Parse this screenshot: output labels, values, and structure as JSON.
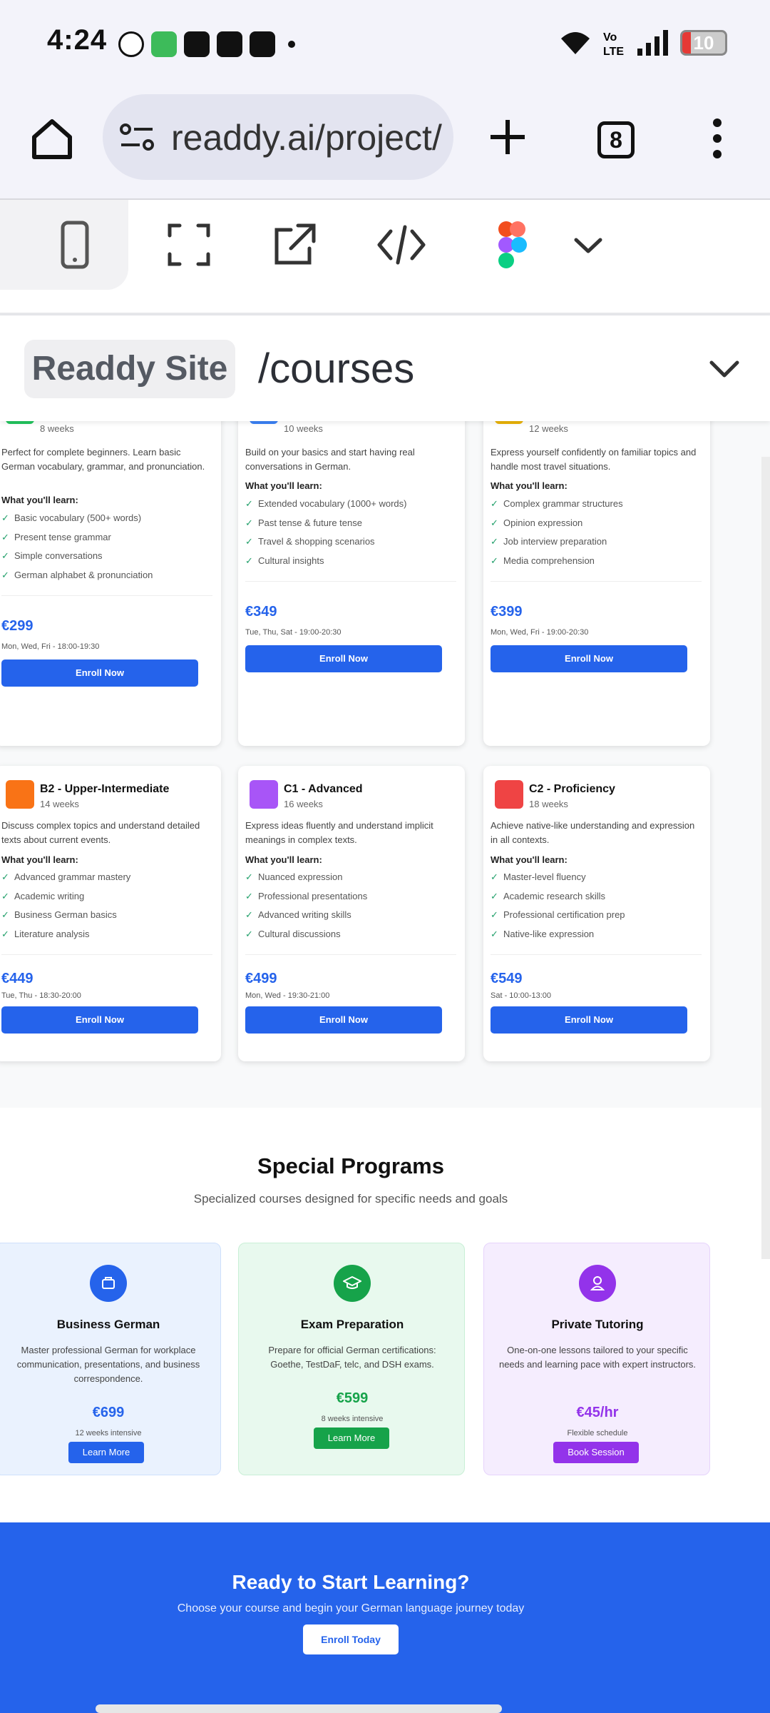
{
  "status_bar": {
    "time": "4:24",
    "battery": "10"
  },
  "browser": {
    "url": "readdy.ai/project/",
    "tab_count": "8"
  },
  "readdy": {
    "site_label": "Readdy Site",
    "path": "/courses"
  },
  "courses": [
    {
      "title": "",
      "duration": "8 weeks",
      "color": "#22c55e",
      "description": "Perfect for complete beginners. Learn basic German vocabulary, grammar, and pronunciation.",
      "learn_label": "What you'll learn:",
      "items": [
        "Basic vocabulary (500+ words)",
        "Present tense grammar",
        "Simple conversations",
        "German alphabet & pronunciation"
      ],
      "price": "€299",
      "schedule": "Mon, Wed, Fri - 18:00-19:30",
      "button": "Enroll Now"
    },
    {
      "title": "",
      "duration": "10 weeks",
      "color": "#3b82f6",
      "description": "Build on your basics and start having real conversations in German.",
      "learn_label": "What you'll learn:",
      "items": [
        "Extended vocabulary (1000+ words)",
        "Past tense & future tense",
        "Travel & shopping scenarios",
        "Cultural insights"
      ],
      "price": "€349",
      "schedule": "Tue, Thu, Sat - 19:00-20:30",
      "button": "Enroll Now"
    },
    {
      "title": "",
      "duration": "12 weeks",
      "color": "#eab308",
      "description": "Express yourself confidently on familiar topics and handle most travel situations.",
      "learn_label": "What you'll learn:",
      "items": [
        "Complex grammar structures",
        "Opinion expression",
        "Job interview preparation",
        "Media comprehension"
      ],
      "price": "€399",
      "schedule": "Mon, Wed, Fri - 19:00-20:30",
      "button": "Enroll Now"
    },
    {
      "title": "B2 - Upper-Intermediate",
      "duration": "14 weeks",
      "color": "#f97316",
      "description": "Discuss complex topics and understand detailed texts about current events.",
      "learn_label": "What you'll learn:",
      "items": [
        "Advanced grammar mastery",
        "Academic writing",
        "Business German basics",
        "Literature analysis"
      ],
      "price": "€449",
      "schedule": "Tue, Thu - 18:30-20:00",
      "button": "Enroll Now"
    },
    {
      "title": "C1 - Advanced",
      "duration": "16 weeks",
      "color": "#a855f7",
      "description": "Express ideas fluently and understand implicit meanings in complex texts.",
      "learn_label": "What you'll learn:",
      "items": [
        "Nuanced expression",
        "Professional presentations",
        "Advanced writing skills",
        "Cultural discussions"
      ],
      "price": "€499",
      "schedule": "Mon, Wed - 19:30-21:00",
      "button": "Enroll Now"
    },
    {
      "title": "C2 - Proficiency",
      "duration": "18 weeks",
      "color": "#ef4444",
      "description": "Achieve native-like understanding and expression in all contexts.",
      "learn_label": "What you'll learn:",
      "items": [
        "Master-level fluency",
        "Academic research skills",
        "Professional certification prep",
        "Native-like expression"
      ],
      "price": "€549",
      "schedule": "Sat - 10:00-13:00",
      "button": "Enroll Now"
    }
  ],
  "special": {
    "title": "Special Programs",
    "subtitle": "Specialized courses designed for specific needs and goals",
    "programs": [
      {
        "title": "Business German",
        "description": "Master professional German for workplace communication, presentations, and business correspondence.",
        "price": "€699",
        "note": "12 weeks intensive",
        "button": "Learn More",
        "accent": "#2563eb",
        "bg": "#eaf2fe",
        "border": "#cfe0fb",
        "icon": "briefcase-icon"
      },
      {
        "title": "Exam Preparation",
        "description": "Prepare for official German certifications: Goethe, TestDaF, telc, and DSH exams.",
        "price": "€599",
        "note": "8 weeks intensive",
        "button": "Learn More",
        "accent": "#16a34a",
        "bg": "#e8f9ee",
        "border": "#c9efd6",
        "icon": "graduation-cap-icon"
      },
      {
        "title": "Private Tutoring",
        "description": "One-on-one lessons tailored to your specific needs and learning pace with expert instructors.",
        "price": "€45/hr",
        "note": "Flexible schedule",
        "button": "Book Session",
        "accent": "#9333ea",
        "bg": "#f5edfe",
        "border": "#e6d4fb",
        "icon": "user-icon"
      }
    ]
  },
  "cta": {
    "title": "Ready to Start Learning?",
    "subtitle": "Choose your course and begin your German language journey today",
    "button": "Enroll Today"
  }
}
